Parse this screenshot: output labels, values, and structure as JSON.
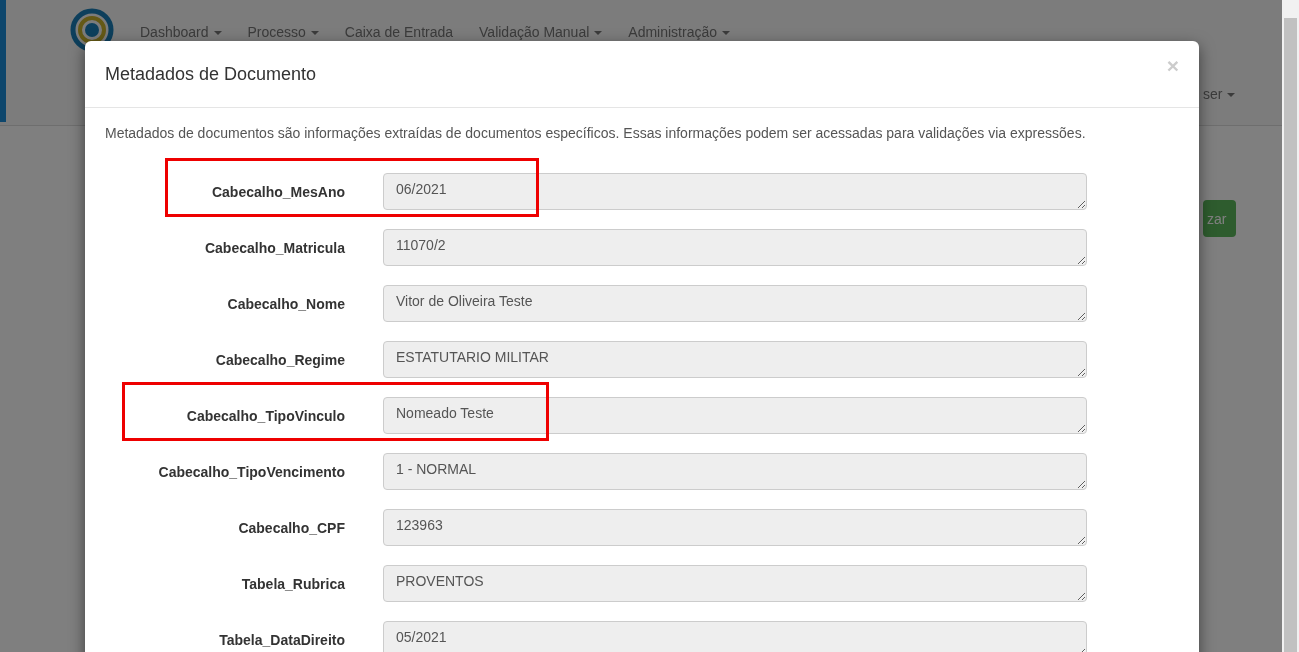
{
  "navbar": {
    "menus": [
      {
        "label": "Dashboard",
        "dropdown": true
      },
      {
        "label": "Processo",
        "dropdown": true
      },
      {
        "label": "Caixa de Entrada",
        "dropdown": false
      },
      {
        "label": "Validação Manual",
        "dropdown": true
      },
      {
        "label": "Administração",
        "dropdown": true
      }
    ],
    "user": {
      "label": "ser",
      "dropdown": true
    }
  },
  "background": {
    "button": "zar"
  },
  "modal": {
    "title": "Metadados de Documento",
    "close": "×",
    "description": "Metadados de documentos são informações extraídas de documentos específicos. Essas informações podem ser acessadas para validações via expressões.",
    "fields": [
      {
        "label": "Cabecalho_MesAno",
        "value": "06/2021",
        "highlighted": true
      },
      {
        "label": "Cabecalho_Matricula",
        "value": "11070/2",
        "highlighted": false
      },
      {
        "label": "Cabecalho_Nome",
        "value": "Vitor de Oliveira Teste",
        "highlighted": false
      },
      {
        "label": "Cabecalho_Regime",
        "value": "ESTATUTARIO MILITAR",
        "highlighted": false
      },
      {
        "label": "Cabecalho_TipoVinculo",
        "value": "Nomeado Teste",
        "highlighted": true
      },
      {
        "label": "Cabecalho_TipoVencimento",
        "value": "1 - NORMAL",
        "highlighted": false
      },
      {
        "label": "Cabecalho_CPF",
        "value": "123963",
        "highlighted": false
      },
      {
        "label": "Tabela_Rubrica",
        "value": "PROVENTOS",
        "highlighted": false
      },
      {
        "label": "Tabela_DataDireito",
        "value": "05/2021",
        "highlighted": false
      }
    ]
  }
}
